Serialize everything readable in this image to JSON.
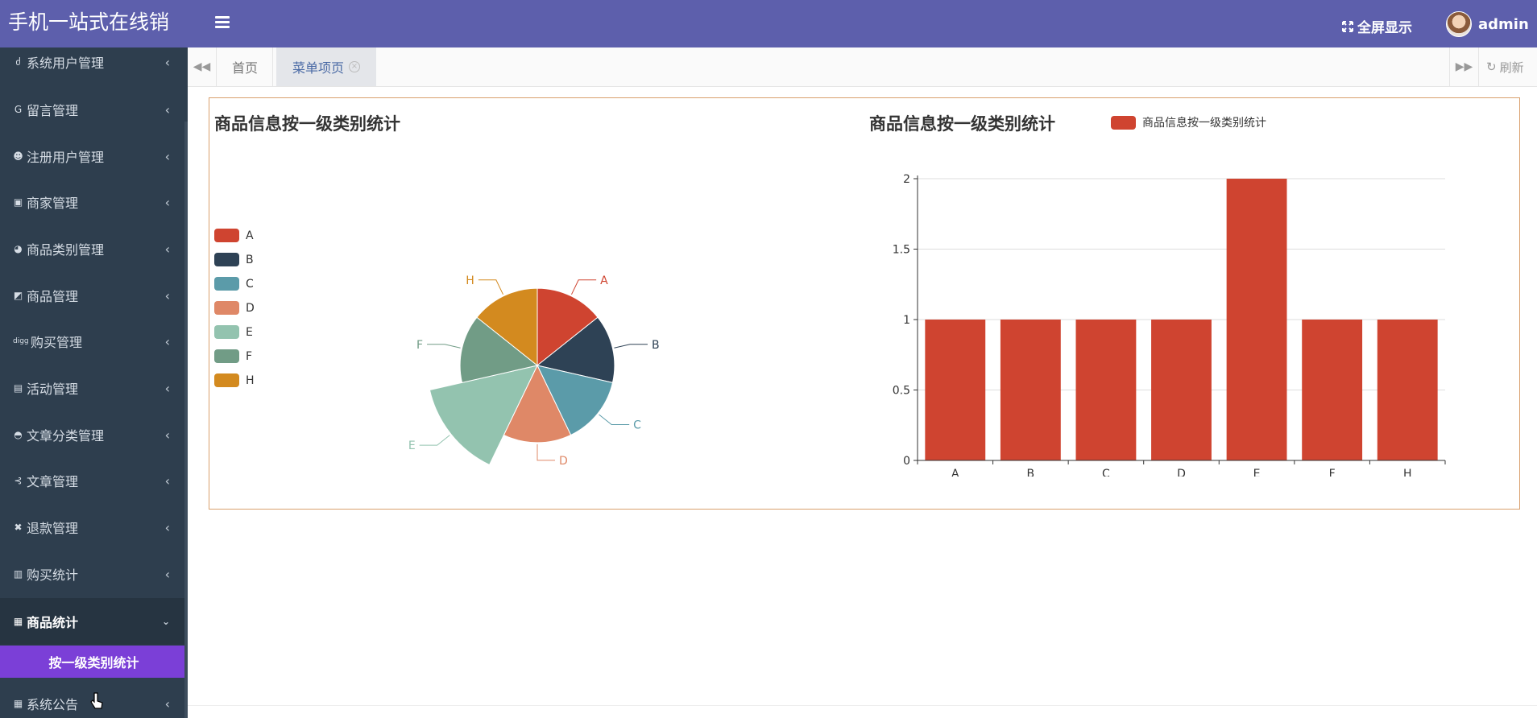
{
  "header": {
    "brand": "手机一站式在线销",
    "fullscreen_label": "全屏显示",
    "user_name": "admin"
  },
  "sidebar": {
    "items": [
      {
        "label": "系统用户管理",
        "icon": "user-icon"
      },
      {
        "label": "留言管理",
        "icon": "google-icon"
      },
      {
        "label": "注册用户管理",
        "icon": "reddit-icon"
      },
      {
        "label": "商家管理",
        "icon": "store-icon"
      },
      {
        "label": "商品类别管理",
        "icon": "category-icon"
      },
      {
        "label": "商品管理",
        "icon": "goods-icon"
      },
      {
        "label": "购买管理",
        "icon": "digg-icon"
      },
      {
        "label": "活动管理",
        "icon": "activity-icon"
      },
      {
        "label": "文章分类管理",
        "icon": "article-category-icon"
      },
      {
        "label": "文章管理",
        "icon": "article-icon"
      },
      {
        "label": "退款管理",
        "icon": "refund-icon"
      },
      {
        "label": "购买统计",
        "icon": "purchase-stats-icon"
      },
      {
        "label": "商品统计",
        "icon": "goods-stats-icon",
        "open": true
      },
      {
        "label": "系统公告",
        "icon": "notice-icon"
      }
    ],
    "sub_item": "按一级类别统计"
  },
  "tabs": {
    "home": "首页",
    "active": "菜单项页",
    "refresh": "刷新"
  },
  "colors": {
    "header": "#5d5fac",
    "sidebar": "#2e3e4e",
    "submenu_active": "#7b3fd7",
    "bar": "#cf4430"
  },
  "chart_data": [
    {
      "type": "pie",
      "title": "商品信息按一级类别统计",
      "legend_position": "left",
      "categories": [
        "A",
        "B",
        "C",
        "D",
        "E",
        "F",
        "H"
      ],
      "values": [
        1,
        1,
        1,
        1,
        2,
        1,
        1
      ],
      "colors": [
        "#cf4430",
        "#2e4255",
        "#5b9ba9",
        "#df8867",
        "#93c3af",
        "#719c86",
        "#d38a1f"
      ]
    },
    {
      "type": "bar",
      "title": "商品信息按一级类别统计",
      "legend_position": "top",
      "series": [
        {
          "name": "商品信息按一级类别统计",
          "values": [
            1,
            1,
            1,
            1,
            2,
            1,
            1
          ]
        }
      ],
      "categories": [
        "A",
        "B",
        "C",
        "D",
        "E",
        "F",
        "H"
      ],
      "yticks": [
        "0",
        "0.5",
        "1",
        "1.5",
        "2"
      ],
      "ylim": [
        0,
        2
      ],
      "grid": true
    }
  ]
}
